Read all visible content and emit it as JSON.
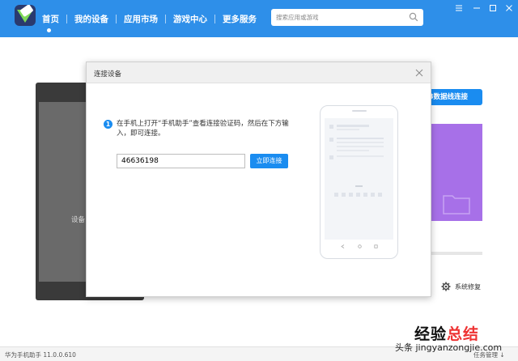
{
  "app": {
    "nav": [
      "首页",
      "我的设备",
      "应用市场",
      "游戏中心",
      "更多服务"
    ],
    "search_placeholder": "搜索应用或游戏"
  },
  "background": {
    "device_label": "设备",
    "usb_button": "B数据线连接",
    "repair_label": "系统修复"
  },
  "dialog": {
    "title": "连接设备",
    "step_number": "1",
    "instruction": "在手机上打开“手机助手”查看连接验证码，然后在下方输入，即可连接。",
    "code_value": "46636198",
    "connect_button": "立即连接"
  },
  "status": {
    "version": "华为手机助手 11.0.0.610",
    "task_manager": "任务管理 ↓"
  },
  "watermark": {
    "title_a": "经验",
    "title_b": "总结",
    "url": "头条 jingyanzongjie.com"
  },
  "icons": {
    "logo": "huawei-hisuite-logo",
    "search": "search-icon",
    "repair": "gear-icon",
    "close": "close-icon"
  },
  "colors": {
    "accent": "#2e8fe9",
    "button": "#1a8cf0",
    "purple_card": "#a770e8"
  }
}
